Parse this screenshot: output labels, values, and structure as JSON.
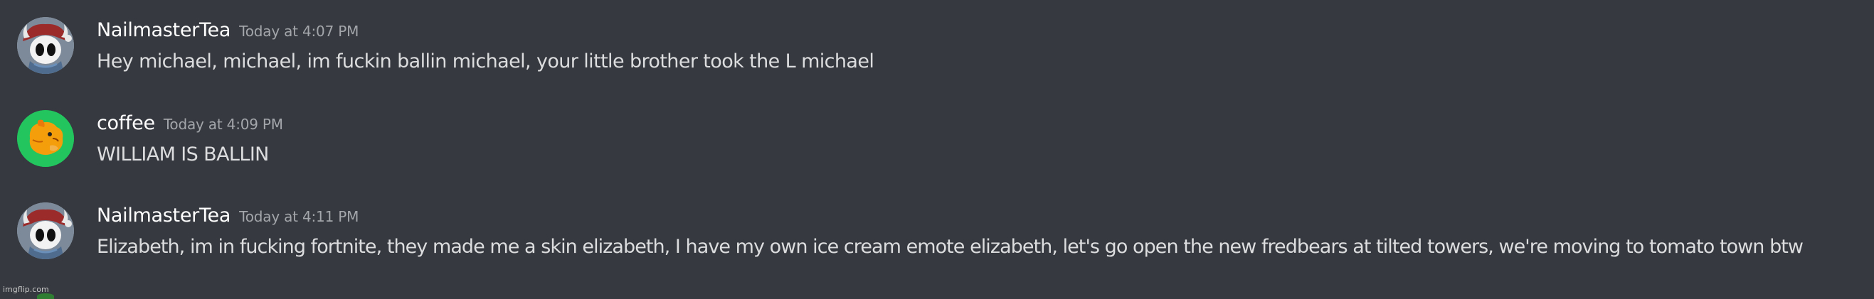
{
  "messages": [
    {
      "username": "NailmasterTea",
      "timestamp": "Today at 4:07 PM",
      "content": "Hey michael, michael, im fuckin ballin michael, your little brother took the L michael",
      "avatar_icon": "hollow-knight-santa-avatar"
    },
    {
      "username": "coffee",
      "timestamp": "Today at 4:09 PM",
      "content": "WILLIAM IS BALLIN",
      "avatar_icon": "orange-dog-avatar"
    },
    {
      "username": "NailmasterTea",
      "timestamp": "Today at 4:11 PM",
      "content": "Elizabeth, im in fucking fortnite, they made me a skin elizabeth, I have my own ice cream emote elizabeth, let's go open the new fredbears at tilted towers, we're moving to tomato town btw",
      "avatar_icon": "hollow-knight-santa-avatar"
    }
  ],
  "watermark": "imgflip.com",
  "colors": {
    "background": "#36393f",
    "username": "#ffffff",
    "timestamp": "#a3a6aa",
    "content": "#dcddde"
  }
}
